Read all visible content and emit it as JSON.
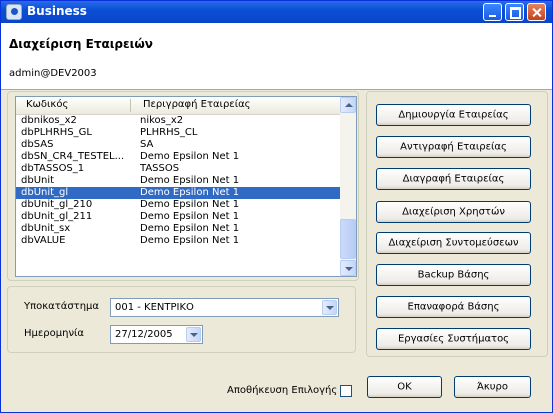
{
  "window": {
    "title": "Business"
  },
  "header": {
    "title": "Διαχείριση Εταιρειών",
    "user": "admin@DEV2003"
  },
  "list": {
    "columns": [
      "Κωδικός",
      "Περιγραφή Εταιρείας"
    ],
    "rows": [
      [
        "dbnikos_x2",
        "nikos_x2"
      ],
      [
        "dbPLHRHS_GL",
        "PLHRHS_CL"
      ],
      [
        "dbSAS",
        "SA"
      ],
      [
        "dbSN_CR4_TESTEL...",
        "Demo Epsilon Net 1"
      ],
      [
        "dbTASSOS_1",
        "TASSOS"
      ],
      [
        "dbUnit",
        "Demo Epsilon Net 1"
      ],
      [
        "dbUnit_gl",
        "Demo Epsilon Net 1"
      ],
      [
        "dbUnit_gl_210",
        "Demo Epsilon Net 1"
      ],
      [
        "dbUnit_gl_211",
        "Demo Epsilon Net 1"
      ],
      [
        "dbUnit_sx",
        "Demo Epsilon Net 1"
      ],
      [
        "dbVALUE",
        "Demo Epsilon Net 1"
      ]
    ],
    "selected_index": 6
  },
  "branch": {
    "label": "Υποκατάστημα",
    "value": "001 - ΚΕΝΤΡΙΚΟ"
  },
  "date": {
    "label": "Ημερομηνία",
    "value": "27/12/2005"
  },
  "actions": {
    "create": "Δημιουργία Εταιρείας",
    "copy": "Αντιγραφή Εταιρείας",
    "delete": "Διαγραφή Εταιρείας",
    "users": "Διαχείριση Χρηστών",
    "shortcuts": "Διαχείριση Συντομεύσεων",
    "backup": "Backup Βάσης",
    "restore": "Επαναφορά Βάσης",
    "tasks": "Εργασίες Συστήματος"
  },
  "footer": {
    "save_label": "Αποθήκευση Επιλογής",
    "save_checked": false,
    "ok": "OK",
    "cancel": "Άκυρο"
  }
}
